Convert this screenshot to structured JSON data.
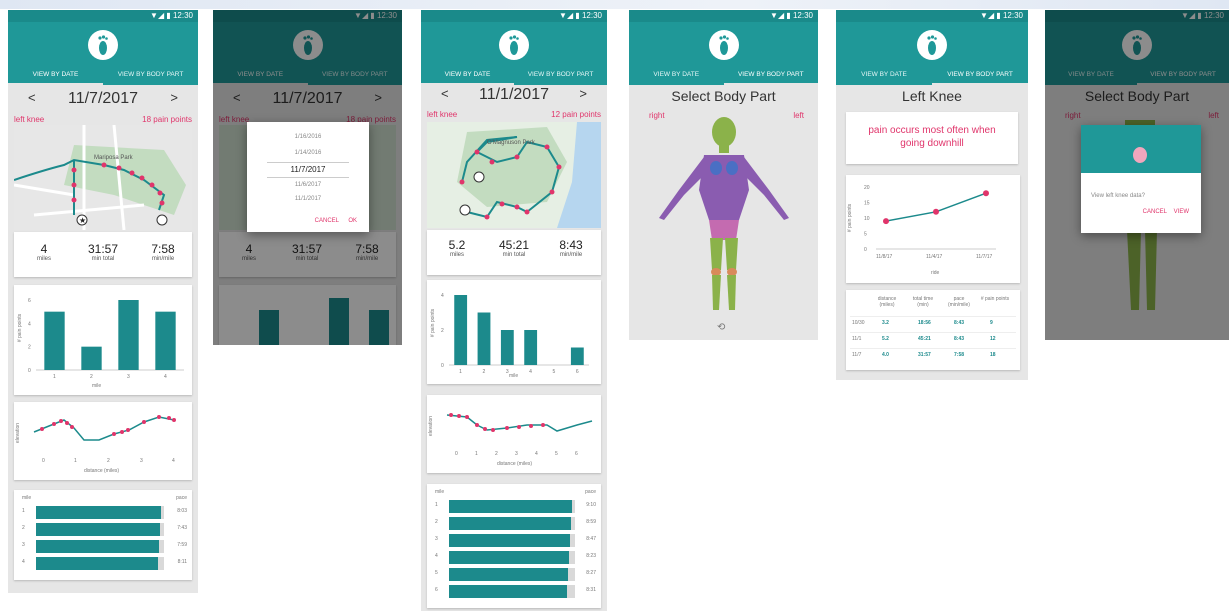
{
  "status": {
    "time": "12:30"
  },
  "tabs": {
    "by_date": "VIEW BY DATE",
    "by_body": "VIEW BY BODY PART"
  },
  "screen1": {
    "date": "11/7/2017",
    "prev": "<",
    "next": ">",
    "part": "left knee",
    "points": "18 pain points",
    "stats": [
      {
        "v": "4",
        "l": "miles"
      },
      {
        "v": "31:57",
        "l": "min total"
      },
      {
        "v": "7:58",
        "l": "min/mile"
      }
    ],
    "bar_xlabel": "mile",
    "bar_ylabel": "# pain points",
    "bar_ticks_y": [
      "6",
      "4",
      "2",
      "0"
    ],
    "bar_ticks_x": [
      "1",
      "2",
      "3",
      "4"
    ],
    "elev_ylabel": "elevation",
    "elev_xlabel": "distance (miles)",
    "elev_ticks_x": [
      "0",
      "1",
      "2",
      "3",
      "4"
    ],
    "pace_head_left": "mile",
    "pace_head_right": "pace",
    "pace_rows": [
      {
        "m": "1",
        "p": "8:03"
      },
      {
        "m": "2",
        "p": "7:43"
      },
      {
        "m": "3",
        "p": "7:59"
      },
      {
        "m": "4",
        "p": "8:11"
      }
    ],
    "map_label": "Mariposa Park"
  },
  "screen2": {
    "date": "11/7/2017",
    "prev": "<",
    "next": ">",
    "part": "left knee",
    "points": "18 pain points",
    "picker": [
      "1/16/2016",
      "1/14/2016",
      "11/7/2017",
      "11/6/2017",
      "11/1/2017"
    ],
    "cancel": "CANCEL",
    "ok": "OK",
    "stats": [
      {
        "v": "4",
        "l": "miles"
      },
      {
        "v": "31:57",
        "l": "min total"
      },
      {
        "v": "7:58",
        "l": "min/mile"
      }
    ]
  },
  "screen3": {
    "date": "11/1/2017",
    "prev": "<",
    "next": ">",
    "part": "left knee",
    "points": "12 pain points",
    "stats": [
      {
        "v": "5.2",
        "l": "miles"
      },
      {
        "v": "45:21",
        "l": "min total"
      },
      {
        "v": "8:43",
        "l": "min/mile"
      }
    ],
    "bar_xlabel": "mile",
    "bar_ylabel": "# pain points",
    "bar_ticks_y": [
      "4",
      "2",
      "0"
    ],
    "bar_ticks_x": [
      "1",
      "2",
      "3",
      "4",
      "5",
      "6"
    ],
    "elev_ylabel": "elevation",
    "elev_xlabel": "distance (miles)",
    "elev_ticks_x": [
      "0",
      "1",
      "2",
      "3",
      "4",
      "5",
      "6"
    ],
    "pace_head_left": "mile",
    "pace_head_right": "pace",
    "pace_rows": [
      {
        "m": "1",
        "p": "9:10"
      },
      {
        "m": "2",
        "p": "8:59"
      },
      {
        "m": "3",
        "p": "8:47"
      },
      {
        "m": "4",
        "p": "8:23"
      },
      {
        "m": "5",
        "p": "8:27"
      },
      {
        "m": "6",
        "p": "8:31"
      }
    ],
    "map_label": "O'Magnuson Park",
    "map_label2": "Warren G. Magnuson Park"
  },
  "screen4": {
    "title": "Select Body Part",
    "right": "right",
    "left": "left"
  },
  "screen5": {
    "title": "Left Knee",
    "insight": "pain occurs most often when going downhill",
    "line_ylabel": "# pain points",
    "line_xlabel": "ride",
    "line_ticks_y": [
      "20",
      "15",
      "10",
      "5",
      "0"
    ],
    "line_ticks_x": [
      "11/8/17",
      "11/4/17",
      "11/7/17"
    ],
    "table_headers": [
      "distance (miles)",
      "total time (min)",
      "pace (min/mile)",
      "# pain points"
    ],
    "table_rows": [
      {
        "d": "10/30",
        "a": "3.2",
        "b": "18:56",
        "c": "8:43",
        "e": "9"
      },
      {
        "d": "11/1",
        "a": "5.2",
        "b": "45:21",
        "c": "8:43",
        "e": "12"
      },
      {
        "d": "11/7",
        "a": "4.0",
        "b": "31:57",
        "c": "7:58",
        "e": "18"
      }
    ]
  },
  "screen6": {
    "title": "Select Body Part",
    "right": "right",
    "left": "left",
    "dialog_text": "View left knee data?",
    "cancel": "CANCEL",
    "view": "VIEW"
  },
  "chart_data": [
    {
      "type": "bar",
      "categories": [
        "1",
        "2",
        "3",
        "4"
      ],
      "values": [
        5,
        2,
        6,
        5
      ],
      "xlabel": "mile",
      "ylabel": "# pain points",
      "ylim": [
        0,
        6
      ]
    },
    {
      "type": "bar",
      "categories": [
        "1",
        "2",
        "3",
        "4",
        "5",
        "6"
      ],
      "values": [
        4,
        3,
        2,
        2,
        0,
        1
      ],
      "xlabel": "mile",
      "ylabel": "# pain points",
      "ylim": [
        0,
        4
      ]
    },
    {
      "type": "line",
      "x": [
        "11/8/17",
        "11/4/17",
        "11/7/17"
      ],
      "values": [
        9,
        12,
        18
      ],
      "xlabel": "ride",
      "ylabel": "# pain points",
      "ylim": [
        0,
        20
      ]
    }
  ],
  "colors": {
    "teal": "#1f9898",
    "bar": "#1c8a8c",
    "pink": "#e0356b",
    "bg": "#e6e6e6"
  }
}
